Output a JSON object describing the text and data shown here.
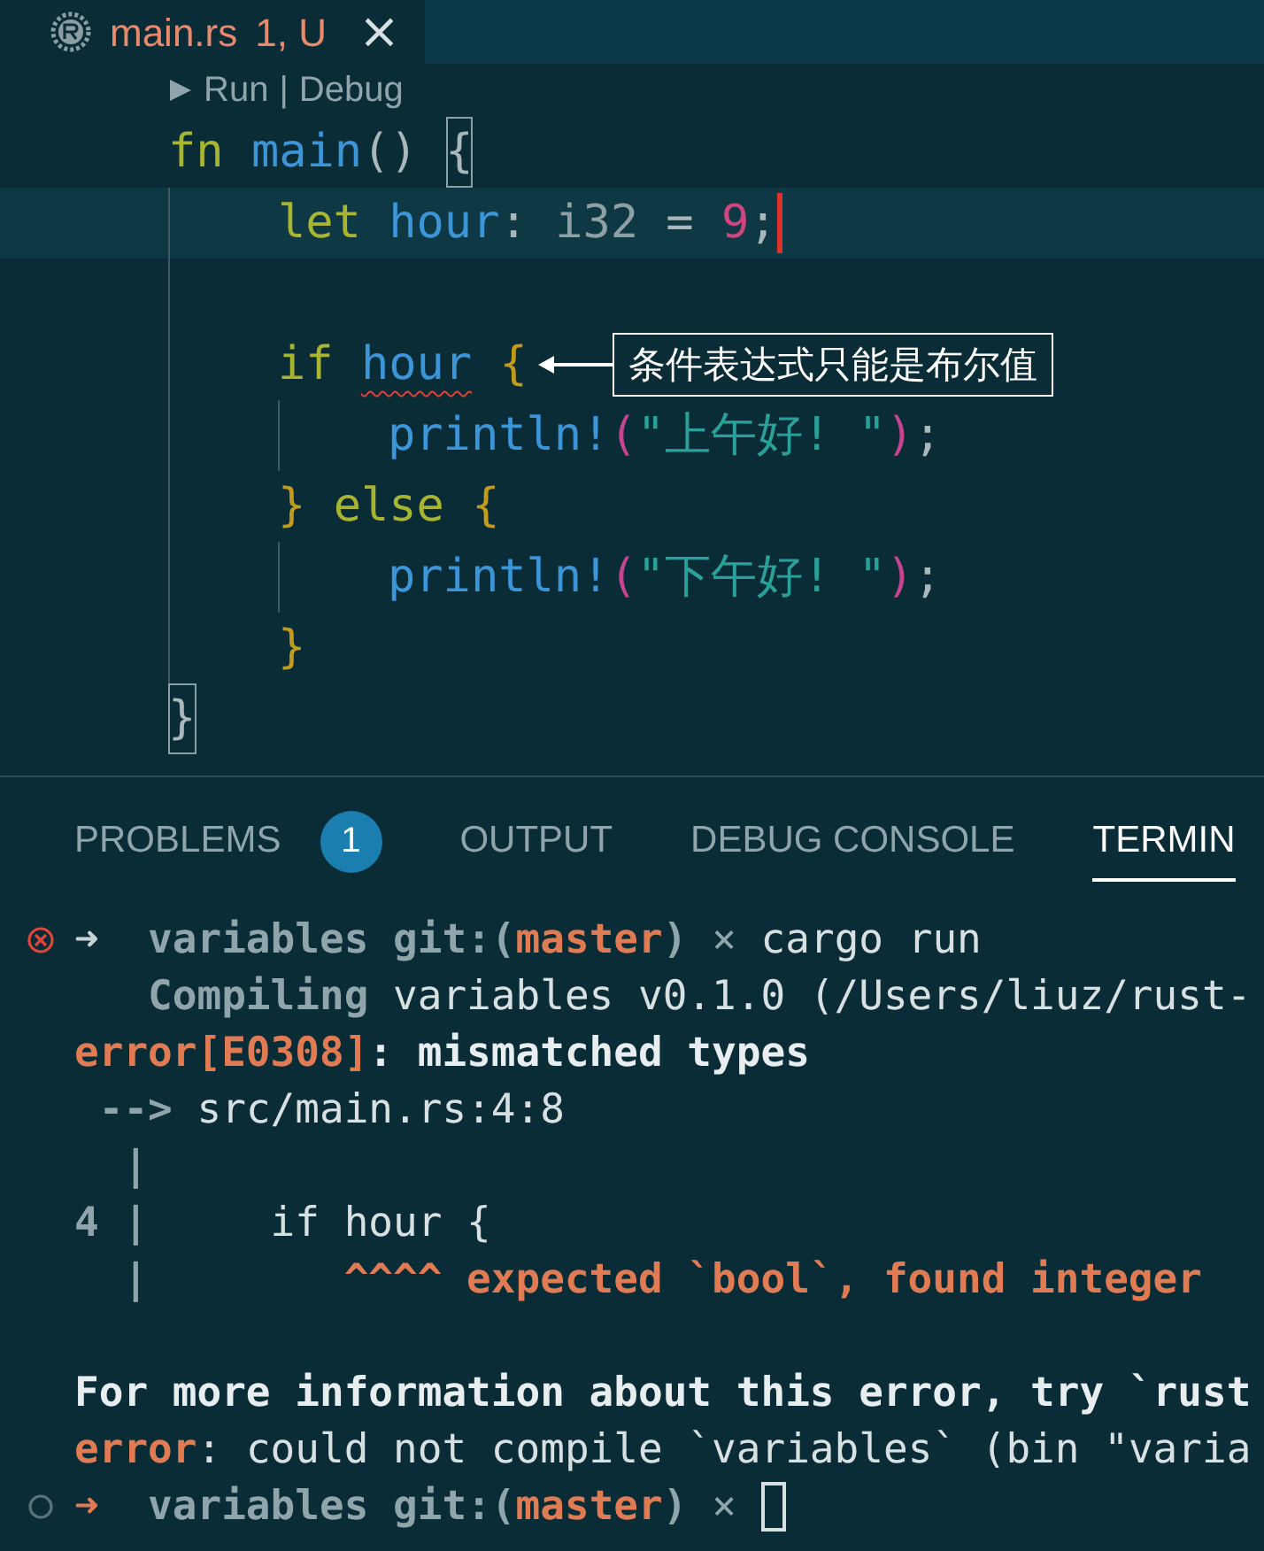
{
  "editor_tab": {
    "filename": "main.rs",
    "status": "1, U",
    "close": "×",
    "selected": true
  },
  "codelens": {
    "run": "Run",
    "separator": "|",
    "debug": "Debug"
  },
  "code_lines": [
    {
      "kind": "code",
      "tokens": [
        {
          "text": "fn ",
          "kind": "keyword"
        },
        {
          "text": "main",
          "kind": "function"
        },
        {
          "text": "() ",
          "kind": "punct"
        },
        {
          "text": "{",
          "kind": "punct",
          "matched": true
        }
      ],
      "current": false,
      "children": [
        {
          "kind": "code",
          "tokens": [
            {
              "text": "let ",
              "kind": "keyword"
            },
            {
              "text": "hour",
              "kind": "variable"
            },
            {
              "text": ": ",
              "kind": "punct"
            },
            {
              "text": "i32",
              "kind": "type"
            },
            {
              "text": " = ",
              "kind": "punct"
            },
            {
              "text": "9",
              "kind": "number"
            },
            {
              "text": ";",
              "kind": "punct"
            }
          ],
          "current": true
        },
        {
          "kind": "blank"
        },
        {
          "kind": "code",
          "tokens": [
            {
              "text": "if ",
              "kind": "keyword"
            },
            {
              "text": "hour",
              "kind": "variable",
              "error": true
            },
            {
              "text": " {",
              "kind": "brace"
            }
          ],
          "current": false,
          "annotation": "条件表达式只能是布尔值",
          "children": [
            {
              "kind": "code",
              "tokens": [
                {
                  "text": "println!",
                  "kind": "function"
                },
                {
                  "text": "(",
                  "kind": "paren"
                },
                {
                  "text": "\"上午好! \"",
                  "kind": "string"
                },
                {
                  "text": ")",
                  "kind": "paren"
                },
                {
                  "text": ";",
                  "kind": "punct"
                }
              ],
              "current": false
            }
          ]
        },
        {
          "kind": "code",
          "tokens": [
            {
              "text": "} ",
              "kind": "brace"
            },
            {
              "text": "else ",
              "kind": "keyword"
            },
            {
              "text": "{",
              "kind": "brace"
            }
          ],
          "current": false,
          "children": [
            {
              "kind": "code",
              "tokens": [
                {
                  "text": "println!",
                  "kind": "function"
                },
                {
                  "text": "(",
                  "kind": "paren"
                },
                {
                  "text": "\"下午好! \"",
                  "kind": "string"
                },
                {
                  "text": ")",
                  "kind": "paren"
                },
                {
                  "text": ";",
                  "kind": "punct"
                }
              ],
              "current": false
            }
          ]
        },
        {
          "kind": "code",
          "tokens": [
            {
              "text": "}",
              "kind": "brace"
            }
          ],
          "current": false
        }
      ]
    },
    {
      "kind": "code",
      "tokens": [
        {
          "text": "}",
          "kind": "punct",
          "matched": true
        }
      ],
      "current": false
    }
  ],
  "panel_tabs": [
    {
      "label": "PROBLEMS",
      "badge": "1",
      "selected": false
    },
    {
      "label": "OUTPUT",
      "selected": false
    },
    {
      "label": "DEBUG CONSOLE",
      "selected": false
    },
    {
      "label": "TERMIN",
      "selected": true
    }
  ],
  "terminal_lines": [
    {
      "kind": "prompt-failed",
      "segments": [
        {
          "text": "➜  ",
          "kind": "arrow"
        },
        {
          "text": "variables ",
          "kind": "dir"
        },
        {
          "text": "git:(",
          "kind": "git"
        },
        {
          "text": "master",
          "kind": "branch"
        },
        {
          "text": ") ",
          "kind": "git"
        },
        {
          "text": "× ",
          "kind": "dirty"
        },
        {
          "text": "cargo run",
          "kind": "plain"
        }
      ]
    },
    {
      "kind": "output",
      "segments": [
        {
          "text": "   Compiling",
          "kind": "dim-bold"
        },
        {
          "text": " variables v0.1.0 (/Users/liuz/rust-",
          "kind": "plain"
        }
      ]
    },
    {
      "kind": "output",
      "segments": [
        {
          "text": "error[E0308]",
          "kind": "error"
        },
        {
          "text": ": mismatched types",
          "kind": "bold"
        }
      ]
    },
    {
      "kind": "output",
      "segments": [
        {
          "text": " --> ",
          "kind": "dim-bold"
        },
        {
          "text": "src/main.rs:4:8",
          "kind": "plain"
        }
      ]
    },
    {
      "kind": "output",
      "segments": [
        {
          "text": "  |",
          "kind": "dim-bold"
        }
      ]
    },
    {
      "kind": "output",
      "segments": [
        {
          "text": "4 |",
          "kind": "dim-bold"
        },
        {
          "text": "     if hour {",
          "kind": "plain"
        }
      ]
    },
    {
      "kind": "output",
      "segments": [
        {
          "text": "  |",
          "kind": "dim-bold"
        },
        {
          "text": "        ^^^^ expected `bool`, found integer",
          "kind": "error"
        }
      ]
    },
    {
      "kind": "blank"
    },
    {
      "kind": "output",
      "segments": [
        {
          "text": "For more information about this error, try `rust",
          "kind": "bold"
        }
      ]
    },
    {
      "kind": "output",
      "segments": [
        {
          "text": "error",
          "kind": "error"
        },
        {
          "text": ": could not compile `variables` (bin \"varia",
          "kind": "plain"
        }
      ]
    },
    {
      "kind": "prompt-idle",
      "cursor": true,
      "segments": [
        {
          "text": "➜  ",
          "kind": "arrow-alert"
        },
        {
          "text": "variables ",
          "kind": "dir"
        },
        {
          "text": "git:(",
          "kind": "git"
        },
        {
          "text": "master",
          "kind": "branch"
        },
        {
          "text": ") ",
          "kind": "git"
        },
        {
          "text": "× ",
          "kind": "dirty"
        }
      ]
    }
  ]
}
